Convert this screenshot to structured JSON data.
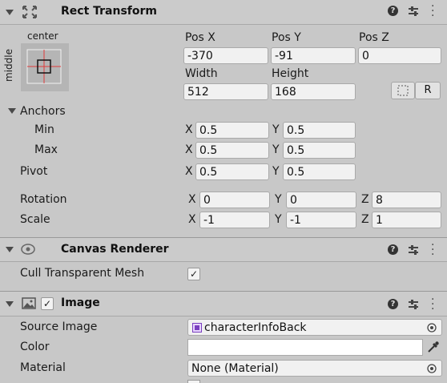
{
  "rect_transform": {
    "title": "Rect Transform",
    "anchor_preset_h": "center",
    "anchor_preset_v": "middle",
    "pos_x_label": "Pos X",
    "pos_y_label": "Pos Y",
    "pos_z_label": "Pos Z",
    "pos_x": "-370",
    "pos_y": "-91",
    "pos_z": "0",
    "width_label": "Width",
    "height_label": "Height",
    "width": "512",
    "height": "168",
    "raw_button_label": "R",
    "anchors_label": "Anchors",
    "min_label": "Min",
    "max_label": "Max",
    "pivot_label": "Pivot",
    "x_axis": "X",
    "y_axis": "Y",
    "z_axis": "Z",
    "min_x": "0.5",
    "min_y": "0.5",
    "max_x": "0.5",
    "max_y": "0.5",
    "pivot_x": "0.5",
    "pivot_y": "0.5",
    "rotation_label": "Rotation",
    "rot_x": "0",
    "rot_y": "0",
    "rot_z": "8",
    "scale_label": "Scale",
    "scale_x": "-1",
    "scale_y": "-1",
    "scale_z": "1"
  },
  "canvas_renderer": {
    "title": "Canvas Renderer",
    "cull_label": "Cull Transparent Mesh",
    "cull_checked": "✓"
  },
  "image": {
    "title": "Image",
    "enabled_check": "✓",
    "source_image_label": "Source Image",
    "source_image_value": "characterInfoBack",
    "color_label": "Color",
    "material_label": "Material",
    "material_value": "None (Material)"
  },
  "colors": {
    "header_bg": "#cbcbcb",
    "body_bg": "#c8c8c8",
    "field_bg": "#f1f1f1"
  },
  "icons": [
    "rect-transform-icon",
    "help-icon",
    "preset-icon",
    "overflow-menu-icon",
    "canvas-renderer-icon",
    "image-component-icon",
    "object-picker-icon",
    "eyedropper-icon",
    "blueprint-icon"
  ]
}
